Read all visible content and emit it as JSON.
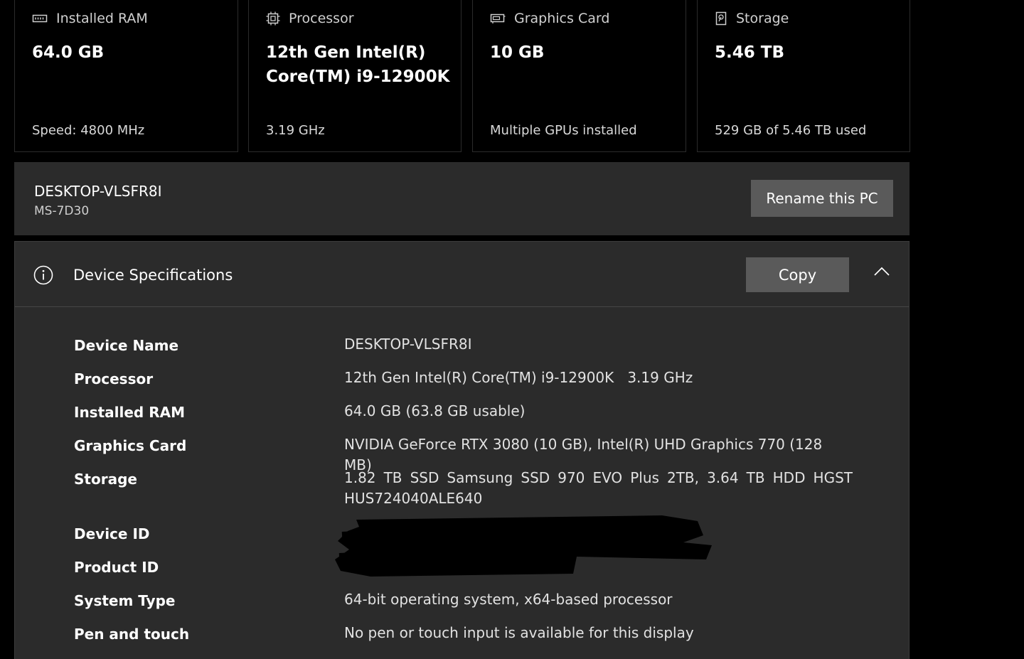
{
  "cards": [
    {
      "icon": "ram-icon",
      "title": "Installed RAM",
      "value": "64.0 GB",
      "footer": "Speed: 4800 MHz"
    },
    {
      "icon": "processor-icon",
      "title": "Processor",
      "value": "12th Gen Intel(R) Core(TM) i9-12900K",
      "footer": "3.19 GHz"
    },
    {
      "icon": "graphics-card-icon",
      "title": "Graphics Card",
      "value": "10 GB",
      "footer": "Multiple GPUs installed"
    },
    {
      "icon": "storage-icon",
      "title": "Storage",
      "value": "5.46 TB",
      "footer": "529 GB of 5.46 TB used"
    }
  ],
  "pc": {
    "name": "DESKTOP-VLSFR8I",
    "model": "MS-7D30",
    "rename_label": "Rename this PC"
  },
  "specs": {
    "title": "Device Specifications",
    "copy_label": "Copy",
    "collapse_icon": "chevron-up-icon",
    "info_icon": "info-icon",
    "rows": [
      {
        "label": "Device Name",
        "value": "DESKTOP-VLSFR8I"
      },
      {
        "label": "Processor",
        "value": "12th Gen Intel(R) Core(TM) i9-12900K   3.19 GHz"
      },
      {
        "label": "Installed RAM",
        "value": "64.0 GB (63.8 GB usable)"
      },
      {
        "label": "Graphics Card",
        "value": "NVIDIA GeForce RTX 3080 (10 GB), Intel(R) UHD Graphics 770 (128 MB)"
      },
      {
        "label": "Storage",
        "value": "1.82 TB SSD Samsung SSD 970 EVO Plus 2TB, 3.64 TB HDD HGST HUS724040ALE640"
      },
      {
        "label": "Device ID",
        "value": ""
      },
      {
        "label": "Product ID",
        "value": ""
      },
      {
        "label": "System Type",
        "value": "64-bit operating system, x64-based processor"
      },
      {
        "label": "Pen and touch",
        "value": "No pen or touch input is available for this display"
      }
    ]
  },
  "colors": {
    "background": "#000000",
    "panel": "#2b2b2b",
    "button": "#5a5a5a",
    "text": "#ffffff",
    "muted_text": "#d0d0d0"
  }
}
